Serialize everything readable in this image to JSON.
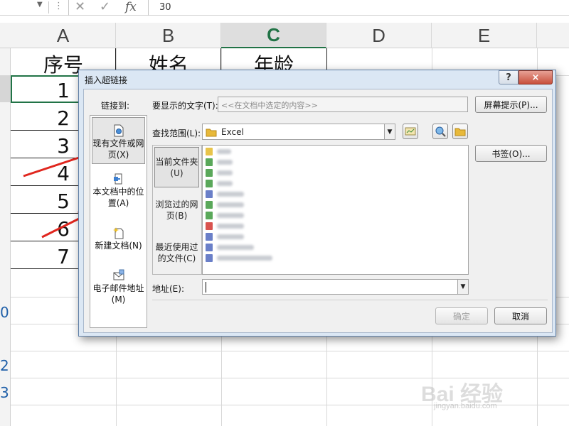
{
  "formula_bar": {
    "value": "30",
    "fx_label": "fx"
  },
  "sheet": {
    "columns": [
      "A",
      "B",
      "C",
      "D",
      "E"
    ],
    "active_column": "C",
    "headers": [
      "序号",
      "姓名",
      "年龄"
    ],
    "row_numbers": [
      "1",
      "2",
      "3",
      "4",
      "5",
      "6",
      "7"
    ]
  },
  "dialog": {
    "title": "插入超链接",
    "help_label": "?",
    "close_label": "×",
    "link_to_label": "链接到:",
    "text_to_display_label": "要显示的文字(T):",
    "text_to_display_value": "<<在文档中选定的内容>>",
    "screentip_button": "屏幕提示(P)...",
    "look_in_label": "查找范围(L):",
    "look_in_value": "Excel",
    "bookmark_button": "书签(O)...",
    "address_label": "地址(E):",
    "address_value": "",
    "ok_button": "确定",
    "cancel_button": "取消",
    "link_types": [
      {
        "label": "现有文件或网页(X)",
        "icon": "web-file-icon",
        "selected": true
      },
      {
        "label": "本文档中的位置(A)",
        "icon": "document-place-icon",
        "selected": false
      },
      {
        "label": "新建文档(N)",
        "icon": "new-document-icon",
        "selected": false
      },
      {
        "label": "电子邮件地址(M)",
        "icon": "email-icon",
        "selected": false
      }
    ],
    "nav_tabs": [
      {
        "label": "当前文件夹(U)",
        "selected": true
      },
      {
        "label": "浏览过的网页(B)",
        "selected": false
      },
      {
        "label": "最近使用过的文件(C)",
        "selected": false
      }
    ],
    "file_icon_colors": [
      "#e8c44a",
      "#5aa85a",
      "#5aa85a",
      "#5aa85a",
      "#6a7fc8",
      "#5aa85a",
      "#5aa85a",
      "#d9534f",
      "#6a7fc8",
      "#6a7fc8",
      "#6a7fc8"
    ]
  },
  "watermark": {
    "brand": "Bai 经验",
    "url": "jingyan.baidu.com"
  }
}
